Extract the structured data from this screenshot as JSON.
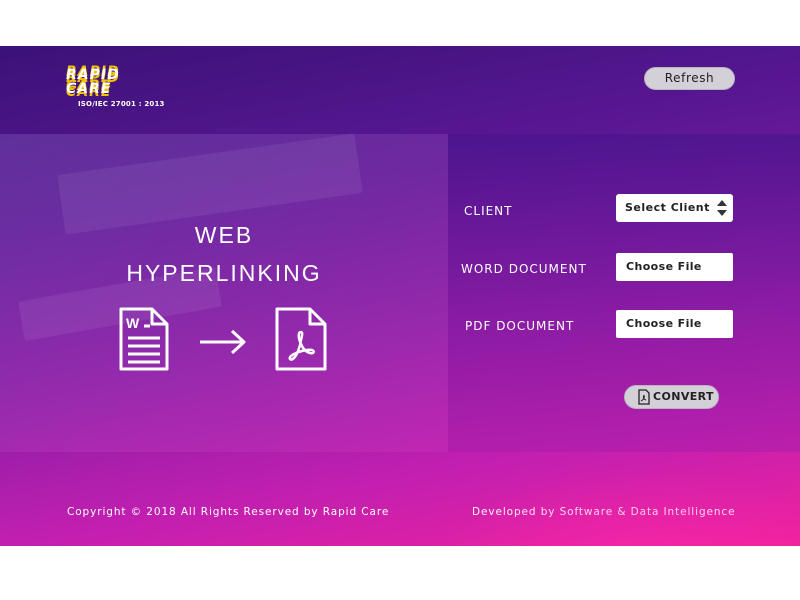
{
  "header": {
    "logo_text": "RAPID CARE",
    "logo_subtext": "ISO/IEC 27001 : 2013",
    "refresh_label": "Refresh"
  },
  "hero": {
    "title_line1": "WEB",
    "title_line2": "HYPERLINKING",
    "word_icon_letter": "W"
  },
  "form": {
    "client_label": "CLIENT",
    "client_select_value": "Select Client",
    "word_label": "WORD DOCUMENT",
    "word_file_button": "Choose File",
    "pdf_label": "PDF DOCUMENT",
    "pdf_file_button": "Choose File",
    "convert_label": "CONVERT"
  },
  "footer": {
    "copyright": "Copyright © 2018 All Rights Reserved by Rapid Care",
    "developed_by": "Developed by Software & Data Intelligence"
  },
  "icons": {
    "word": "word-document-icon",
    "arrow": "arrow-right-icon",
    "pdf": "pdf-document-icon",
    "select": "sort-arrows-icon",
    "convert": "pdf-file-icon"
  },
  "colors": {
    "gradient_top": "#3a1278",
    "gradient_bottom": "#f0229e",
    "button_bg": "#d3d0d8"
  }
}
